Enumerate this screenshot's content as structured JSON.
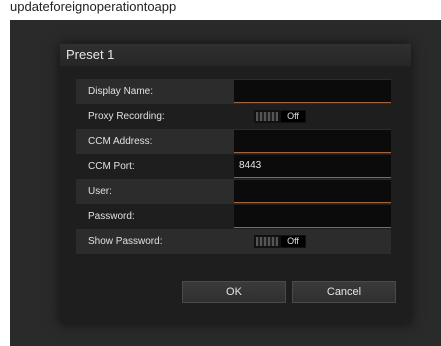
{
  "top_text": "updateforeignoperationtoapp",
  "dialog": {
    "title": "Preset 1",
    "rows": [
      {
        "label": "Display Name:",
        "value": ""
      },
      {
        "label": "Proxy Recording:",
        "toggle": "Off"
      },
      {
        "label": "CCM Address:",
        "value": ""
      },
      {
        "label": "CCM Port:",
        "value": "8443"
      },
      {
        "label": "User:",
        "value": ""
      },
      {
        "label": "Password:",
        "value": ""
      },
      {
        "label": "Show Password:",
        "toggle": "Off"
      }
    ],
    "ok_label": "OK",
    "cancel_label": "Cancel"
  },
  "colors": {
    "backdrop": "#2a2a2a",
    "dialog_bg": "#1e1e1e",
    "field_bg": "#0b0b0b",
    "field_accent": "#a0643c"
  }
}
